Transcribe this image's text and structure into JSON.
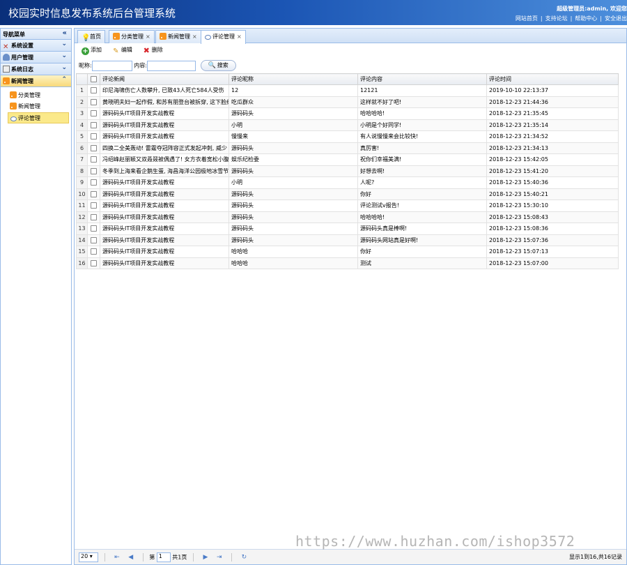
{
  "header": {
    "title": "校园实时信息发布系统后台管理系统",
    "welcome": "超级管理员:admin, 欢迎您",
    "links": [
      "网站首页",
      "支持论坛",
      "帮助中心",
      "安全退出"
    ]
  },
  "sidebar": {
    "title": "导航菜单",
    "groups": [
      {
        "label": "系统设置",
        "icon": "tools-icon"
      },
      {
        "label": "用户管理",
        "icon": "users-icon"
      },
      {
        "label": "系统日志",
        "icon": "log-icon"
      },
      {
        "label": "新闻管理",
        "icon": "rss-icon"
      }
    ],
    "items": [
      {
        "label": "分类管理"
      },
      {
        "label": "新闻管理"
      },
      {
        "label": "评论管理"
      }
    ]
  },
  "tabs": [
    {
      "label": "首页"
    },
    {
      "label": "分类管理",
      "close": "×"
    },
    {
      "label": "新闻管理",
      "close": "×"
    },
    {
      "label": "评论管理",
      "close": "×"
    }
  ],
  "toolbar": {
    "add": "添加",
    "edit": "编辑",
    "delete": "删除"
  },
  "search": {
    "nickname_label": "昵称:",
    "content_label": "内容:",
    "button": "搜索"
  },
  "grid": {
    "columns": [
      "评论新闻",
      "评论昵称",
      "评论内容",
      "评论时间"
    ],
    "rows": [
      {
        "n": "1",
        "news": "印尼海啸伤亡人数攀升, 已致43人死亡584人受伤",
        "nick": "12",
        "content": "12121",
        "time": "2019-10-10 22:13:37"
      },
      {
        "n": "2",
        "news": "黄晓明夫妇一起作假, 和苏有朋登台被拆穿, 这下脸红了",
        "nick": "吃瓜群众",
        "content": "这样就不好了吧!",
        "time": "2018-12-23 21:44:36"
      },
      {
        "n": "3",
        "news": "源码码头IT项目开发实战教程",
        "nick": "源码码头",
        "content": "哈哈哈哈!",
        "time": "2018-12-23 21:35:45"
      },
      {
        "n": "4",
        "news": "源码码头IT项目开发实战教程",
        "nick": "小明",
        "content": "小明是个好同学!",
        "time": "2018-12-23 21:35:14"
      },
      {
        "n": "5",
        "news": "源码码头IT项目开发实战教程",
        "nick": "慢慢来",
        "content": "有人说慢慢来会比较快!",
        "time": "2018-12-23 21:34:52"
      },
      {
        "n": "6",
        "news": "四换二全美轰动! 雷霆夺冠阵容正式发起冲刺, 威少",
        "nick": "源码码头",
        "content": "真厉害!",
        "time": "2018-12-23 21:34:13"
      },
      {
        "n": "7",
        "news": "冯绍峰赵丽颖又双叒叕被偶遇了! 女方衣着宽松小腹",
        "nick": "娱乐纪检委",
        "content": "祝你们幸福美满!",
        "time": "2018-12-23 15:42:05"
      },
      {
        "n": "8",
        "news": "冬季到上海来看企鹅生蛋, 海昌海洋公园极地冰雪节",
        "nick": "源码码头",
        "content": "好想去啊!",
        "time": "2018-12-23 15:41:20"
      },
      {
        "n": "9",
        "news": "源码码头IT项目开发实战教程",
        "nick": "小明",
        "content": "人呢?",
        "time": "2018-12-23 15:40:36"
      },
      {
        "n": "10",
        "news": "源码码头IT项目开发实战教程",
        "nick": "源码码头",
        "content": "你好",
        "time": "2018-12-23 15:40:21"
      },
      {
        "n": "11",
        "news": "源码码头IT项目开发实战教程",
        "nick": "源码码头",
        "content": "评论测试v报告!",
        "time": "2018-12-23 15:30:10"
      },
      {
        "n": "12",
        "news": "源码码头IT项目开发实战教程",
        "nick": "源码码头",
        "content": "哈哈哈哈!",
        "time": "2018-12-23 15:08:43"
      },
      {
        "n": "13",
        "news": "源码码头IT项目开发实战教程",
        "nick": "源码码头",
        "content": "源码码头真是棒啊!",
        "time": "2018-12-23 15:08:36"
      },
      {
        "n": "14",
        "news": "源码码头IT项目开发实战教程",
        "nick": "源码码头",
        "content": "源码码头网站真是好啊!",
        "time": "2018-12-23 15:07:36"
      },
      {
        "n": "15",
        "news": "源码码头IT项目开发实战教程",
        "nick": "哈哈哈",
        "content": "你好",
        "time": "2018-12-23 15:07:13"
      },
      {
        "n": "16",
        "news": "源码码头IT项目开发实战教程",
        "nick": "哈哈哈",
        "content": "测试",
        "time": "2018-12-23 15:07:00"
      }
    ]
  },
  "pager": {
    "page_size": "20",
    "page_prefix": "第",
    "page_value": "1",
    "page_suffix": "共1页",
    "info": "显示1到16,共16记录"
  },
  "watermark": "https://www.huzhan.com/ishop3572"
}
